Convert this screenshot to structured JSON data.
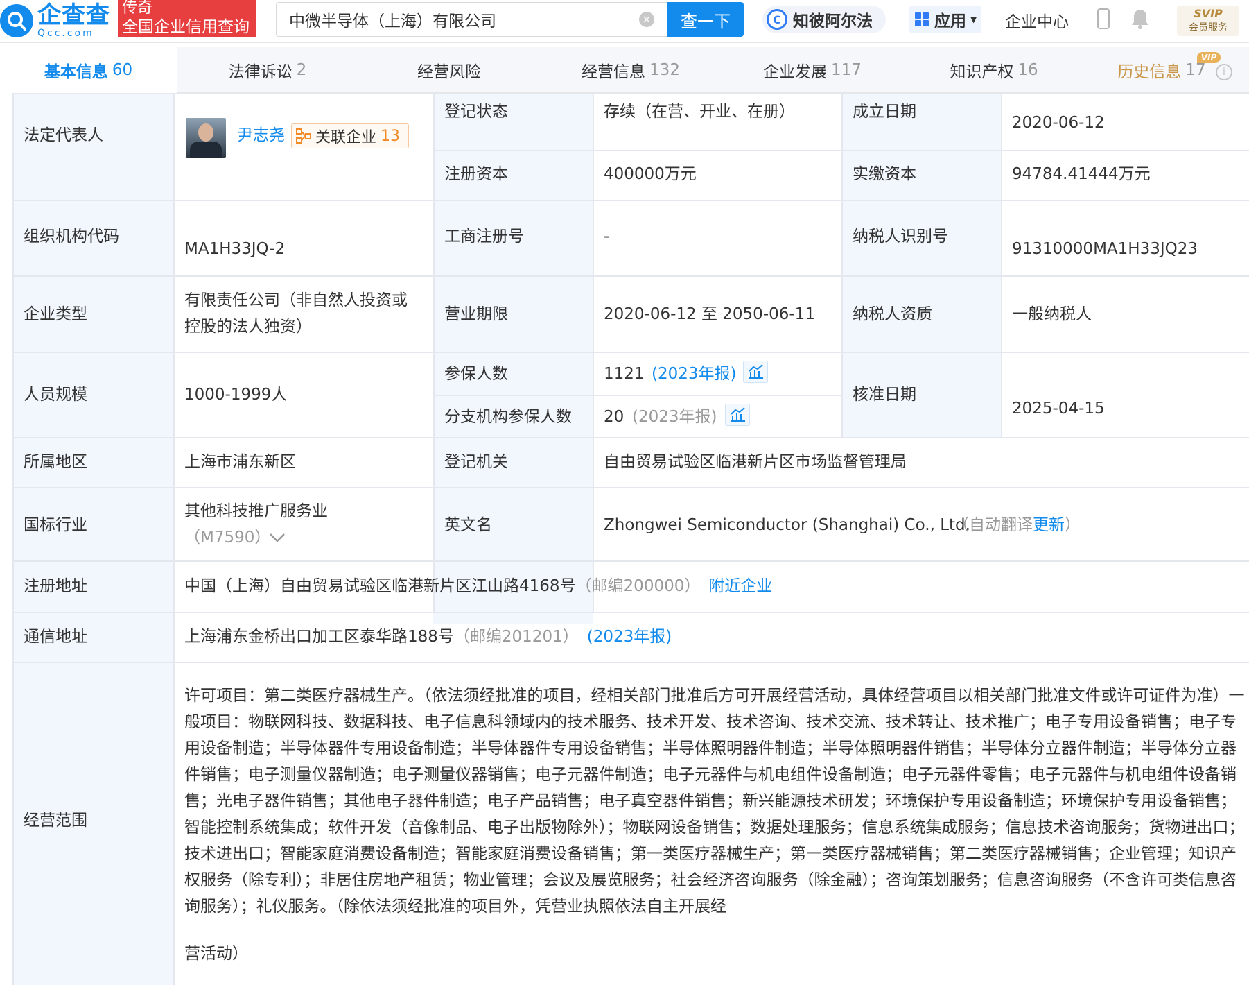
{
  "header": {
    "logo_cn": "企查查",
    "logo_en": "Qcc.com",
    "badge_line1": "传奇",
    "badge_line2": "全国企业信用查询",
    "search_value": "中微半导体（上海）有限公司",
    "search_clear": "×",
    "search_button": "查一下",
    "zhibi_label": "知彼阿尔法",
    "zhibi_letter": "C",
    "apps_label": "应用",
    "enterprise_center": "企业中心",
    "svip_line1": "SVIP",
    "svip_line2": "会员服务"
  },
  "tabs": [
    {
      "label": "基本信息",
      "count": "60"
    },
    {
      "label": "法律诉讼",
      "count": "2"
    },
    {
      "label": "经营风险",
      "count": ""
    },
    {
      "label": "经营信息",
      "count": "132"
    },
    {
      "label": "企业发展",
      "count": "117"
    },
    {
      "label": "知识产权",
      "count": "16"
    },
    {
      "label": "历史信息",
      "count": "17"
    }
  ],
  "vip_tag": "VIP",
  "info_symbol": "i",
  "info": {
    "legal_rep_label": "法定代表人",
    "legal_rep_name": "尹志尧",
    "related_label": "关联企业",
    "related_count": "13",
    "reg_status_label": "登记状态",
    "reg_status": "存续（在营、开业、在册）",
    "found_date_label": "成立日期",
    "found_date": "2020-06-12",
    "reg_capital_label": "注册资本",
    "reg_capital": "400000万元",
    "paid_capital_label": "实缴资本",
    "paid_capital": "94784.41444万元",
    "org_code_label": "组织机构代码",
    "org_code": "MA1H33JQ-2",
    "biz_reg_no_label": "工商注册号",
    "biz_reg_no": "-",
    "taxpayer_id_label": "纳税人识别号",
    "taxpayer_id": "91310000MA1H33JQ23",
    "ent_type_label": "企业类型",
    "ent_type_line1": "有限责任公司（非自然人投资或",
    "ent_type_line2": "控股的法人独资）",
    "biz_term_label": "营业期限",
    "biz_term": "2020-06-12 至 2050-06-11",
    "taxpayer_qual_label": "纳税人资质",
    "taxpayer_qual": "一般纳税人",
    "staff_label": "人员规模",
    "staff": "1000-1999人",
    "insured_label": "参保人数",
    "insured": "1121",
    "insured_report": "(2023年报)",
    "branch_insured_label": "分支机构参保人数",
    "branch_insured": "20",
    "branch_insured_report": "(2023年报)",
    "approve_date_label": "核准日期",
    "approve_date": "2025-04-15",
    "region_label": "所属地区",
    "region": "上海市浦东新区",
    "reg_authority_label": "登记机关",
    "reg_authority": "自由贸易试验区临港新片区市场监督管理局",
    "industry_label": "国标行业",
    "industry": "其他科技推广服务业",
    "industry_code": "（M7590）",
    "english_name_label": "英文名",
    "english_name": "Zhongwei Semiconductor (Shanghai) Co., Ltd.",
    "auto_translate": "（自动翻译",
    "update_link": "更新",
    "auto_translate_end": "）",
    "reg_address_label": "注册地址",
    "reg_address": "中国（上海）自由贸易试验区临港新片区江山路4168号",
    "reg_postcode": "（邮编200000）",
    "nearby_link": "附近企业",
    "mail_address_label": "通信地址",
    "mail_address": "上海浦东金桥出口加工区泰华路188号",
    "mail_postcode": "（邮编201201）",
    "mail_report": "(2023年报)",
    "scope_label": "经营范围",
    "scope": "许可项目：第二类医疗器械生产。（依法须经批准的项目，经相关部门批准后方可开展经营活动，具体经营项目以相关部门批准文件或许可证件为准）一般项目：物联网科技、数据科技、电子信息科领域内的技术服务、技术开发、技术咨询、技术交流、技术转让、技术推广；电子专用设备销售；电子专用设备制造；半导体器件专用设备制造；半导体器件专用设备销售；半导体照明器件制造；半导体照明器件销售；半导体分立器件制造；半导体分立器件销售；电子测量仪器制造；电子测量仪器销售；电子元器件制造；电子元器件与机电组件设备制造；电子元器件零售；电子元器件与机电组件设备销售；光电子器件销售；其他电子器件制造；电子产品销售；电子真空器件销售；新兴能源技术研发；环境保护专用设备制造；环境保护专用设备销售；智能控制系统集成；软件开发（音像制品、电子出版物除外）；物联网设备销售；数据处理服务；信息系统集成服务；信息技术咨询服务；货物进出口；技术进出口；智能家庭消费设备制造；智能家庭消费设备销售；第一类医疗器械生产；第一类医疗器械销售；第二类医疗器械销售；企业管理；知识产权服务（除专利）；非居住房地产租赁；物业管理；会议及展览服务；社会经济咨询服务（除金融）；咨询策划服务；信息咨询服务（不含许可类信息咨询服务）；礼仪服务。（除依法须经批准的项目外，凭营业执照依法自主开展经",
    "scope_tail": "营活动）"
  }
}
